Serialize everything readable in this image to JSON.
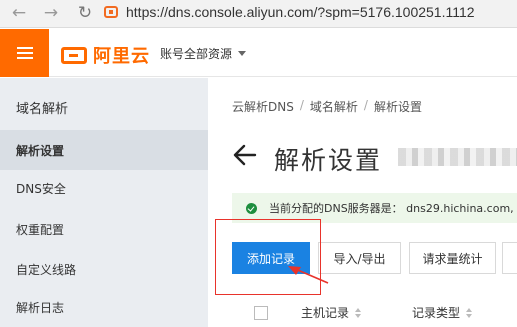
{
  "browser": {
    "back_glyph": "←",
    "forward_glyph": "→",
    "reload_glyph": "↻",
    "url": "https://dns.console.aliyun.com/?spm=5176.100251.1112"
  },
  "header": {
    "logo_text": "阿里云",
    "account_label": "账号全部资源",
    "brand_color": "#ff6a00"
  },
  "sidebar": {
    "title": "域名解析",
    "items": [
      {
        "label": "解析设置",
        "active": true
      },
      {
        "label": "DNS安全"
      },
      {
        "label": "权重配置"
      },
      {
        "label": "自定义线路"
      },
      {
        "label": "解析日志"
      }
    ]
  },
  "main": {
    "breadcrumb": [
      "云解析DNS",
      "域名解析",
      "解析设置"
    ],
    "breadcrumb_sep": "/",
    "title": "解析设置",
    "notice": "当前分配的DNS服务器是： dns29.hichina.com,",
    "buttons": {
      "add": "添加记录",
      "import_export": "导入/导出",
      "stats": "请求量统计"
    },
    "table_headers": [
      "主机记录",
      "记录类型"
    ],
    "primary_color": "#1a82e2",
    "annotation_color": "#e8332b"
  }
}
